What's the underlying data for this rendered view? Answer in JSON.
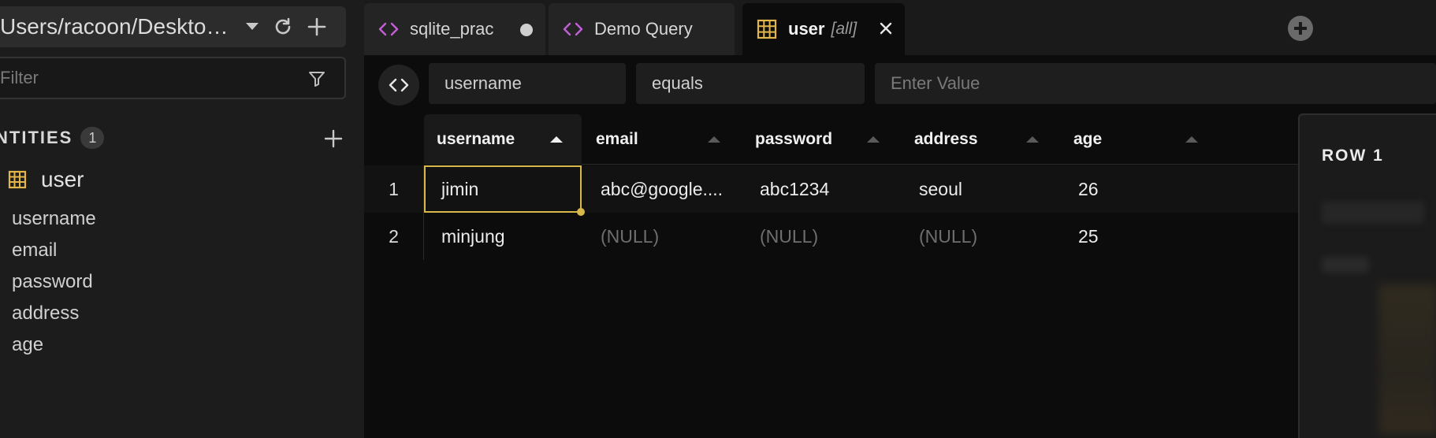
{
  "sidebar": {
    "connection_path": "Users/racoon/Desktop...",
    "filter_placeholder": "Filter",
    "entities_title": "NTITIES",
    "entities_count": "1",
    "entity": {
      "label": "user",
      "icon": "table-icon"
    },
    "fields": [
      "username",
      "email",
      "password",
      "address",
      "age"
    ]
  },
  "tabs": [
    {
      "label": "sqlite_prac",
      "icon": "code-icon",
      "unsaved": true
    },
    {
      "label": "Demo Query",
      "icon": "code-icon"
    },
    {
      "label": "user",
      "sub": "[all]",
      "icon": "table-icon",
      "active": true
    }
  ],
  "filter_bar": {
    "column": "username",
    "operator": "equals",
    "value_placeholder": "Enter Value"
  },
  "grid": {
    "columns": [
      "username",
      "email",
      "password",
      "address",
      "age"
    ],
    "sorted_column": "username",
    "rows": [
      {
        "num": "1",
        "username": "jimin",
        "email": "abc@google....",
        "password": "abc1234",
        "address": "seoul",
        "age": "26"
      },
      {
        "num": "2",
        "username": "minjung",
        "email": "(NULL)",
        "password": "(NULL)",
        "address": "(NULL)",
        "age": "25"
      }
    ]
  },
  "detail_panel": {
    "title": "ROW 1"
  },
  "colors": {
    "accent": "#d9b84a",
    "code_icon": "#c25fd6",
    "table_icon": "#e2b64a",
    "null_text": "#6e6e6e"
  }
}
